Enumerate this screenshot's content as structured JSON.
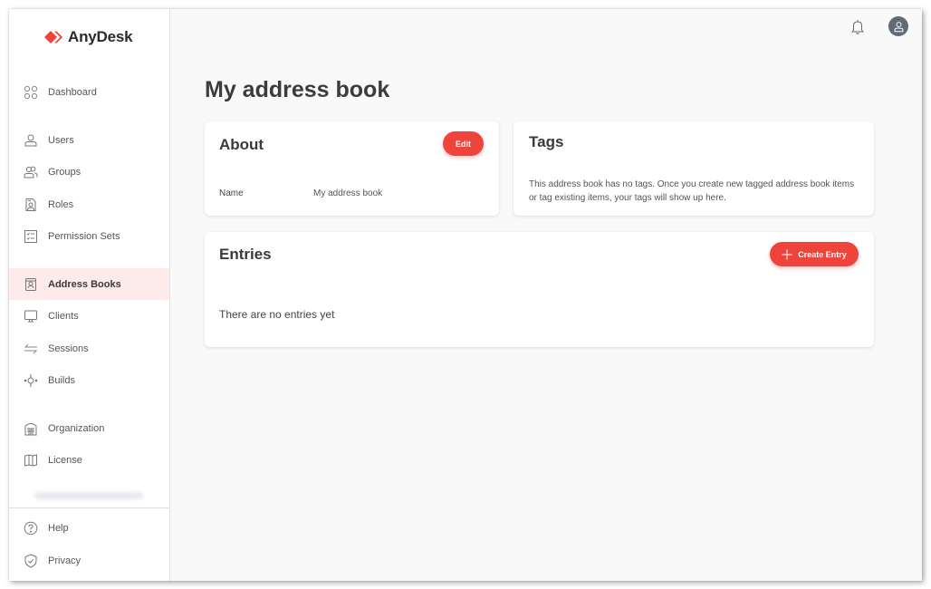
{
  "app": {
    "brand": "AnyDesk",
    "brand_color": "#ef443b"
  },
  "sidebar": {
    "items": [
      {
        "label": "Dashboard",
        "icon": "dashboard-icon"
      },
      {
        "label": "Users",
        "icon": "user-icon"
      },
      {
        "label": "Groups",
        "icon": "groups-icon"
      },
      {
        "label": "Roles",
        "icon": "roles-icon"
      },
      {
        "label": "Permission Sets",
        "icon": "permission-sets-icon"
      },
      {
        "label": "Address Books",
        "icon": "address-book-icon",
        "active": true
      },
      {
        "label": "Clients",
        "icon": "monitor-icon"
      },
      {
        "label": "Sessions",
        "icon": "sessions-icon"
      },
      {
        "label": "Builds",
        "icon": "builds-icon"
      },
      {
        "label": "Organization",
        "icon": "organization-icon"
      },
      {
        "label": "License",
        "icon": "license-icon"
      },
      {
        "label": "Help",
        "icon": "help-icon"
      },
      {
        "label": "Privacy",
        "icon": "privacy-icon"
      }
    ]
  },
  "header": {
    "notifications_icon": "bell-icon",
    "account_icon": "user-avatar-icon"
  },
  "main": {
    "title": "My address book",
    "about": {
      "title": "About",
      "edit_label": "Edit",
      "name_label": "Name",
      "name_value": "My address book"
    },
    "tags": {
      "title": "Tags",
      "description": "This address book has no tags. Once you create new tagged address book items or tag existing items, your tags will show up here."
    },
    "entries": {
      "title": "Entries",
      "create_label": "Create Entry",
      "empty_text": "There are no entries yet"
    }
  }
}
